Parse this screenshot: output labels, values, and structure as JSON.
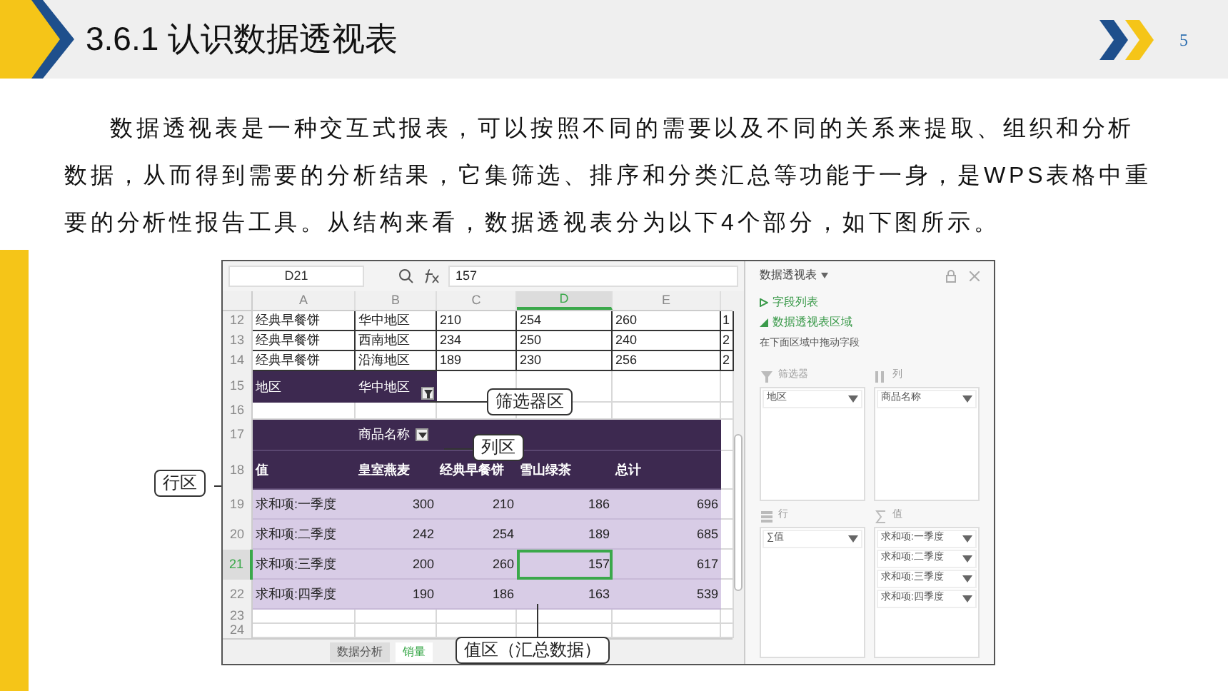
{
  "slide": {
    "title": "3.6.1 认识数据透视表",
    "page_number": "5",
    "paragraph": "数据透视表是一种交互式报表，可以按照不同的需要以及不同的关系来提取、组织和分析数据，从而得到需要的分析结果，它集筛选、排序和分类汇总等功能于一身，是WPS表格中重要的分析性报告工具。从结构来看，数据透视表分为以下4个部分，如下图所示。"
  },
  "spreadsheet": {
    "name_box": "D21",
    "formula": "157",
    "columns": [
      {
        "label": "A",
        "selected": false
      },
      {
        "label": "B",
        "selected": false
      },
      {
        "label": "C",
        "selected": false
      },
      {
        "label": "D",
        "selected": true
      },
      {
        "label": "E",
        "selected": false
      }
    ],
    "rows": [
      {
        "number": "12",
        "kind": "data",
        "selected": false,
        "cells": [
          "经典早餐饼",
          "华中地区",
          "210",
          "254",
          "260",
          "1"
        ]
      },
      {
        "number": "13",
        "kind": "data",
        "selected": false,
        "cells": [
          "经典早餐饼",
          "西南地区",
          "234",
          "250",
          "240",
          "2"
        ]
      },
      {
        "number": "14",
        "kind": "data",
        "selected": false,
        "cells": [
          "经典早餐饼",
          "沿海地区",
          "189",
          "230",
          "256",
          "2"
        ]
      },
      {
        "number": "15",
        "kind": "filter",
        "selected": false,
        "cells": [
          "地区",
          "华中地区"
        ]
      },
      {
        "number": "16",
        "kind": "blank",
        "selected": false,
        "cells": []
      },
      {
        "number": "17",
        "kind": "colfield",
        "selected": false,
        "cells": [
          "",
          "商品名称"
        ]
      },
      {
        "number": "18",
        "kind": "header",
        "selected": false,
        "cells": [
          "值",
          "皇室燕麦",
          "经典早餐饼",
          "雪山绿茶",
          "总计"
        ]
      },
      {
        "number": "19",
        "kind": "value",
        "selected": false,
        "cells": [
          "求和项:一季度",
          "300",
          "210",
          "186",
          "696"
        ]
      },
      {
        "number": "20",
        "kind": "value",
        "selected": false,
        "cells": [
          "求和项:二季度",
          "242",
          "254",
          "189",
          "685"
        ]
      },
      {
        "number": "21",
        "kind": "value",
        "selected": true,
        "cells": [
          "求和项:三季度",
          "200",
          "260",
          "157",
          "617"
        ]
      },
      {
        "number": "22",
        "kind": "value",
        "selected": false,
        "cells": [
          "求和项:四季度",
          "190",
          "186",
          "163",
          "539"
        ]
      },
      {
        "number": "23",
        "kind": "blank",
        "selected": false,
        "cells": []
      },
      {
        "number": "24",
        "kind": "blank",
        "selected": false,
        "cells": []
      }
    ],
    "sheet_tabs": [
      {
        "label": "数据分析",
        "selected": false
      },
      {
        "label": "销量",
        "selected": true
      }
    ]
  },
  "callouts": [
    {
      "kind": "filter",
      "text": "筛选器区"
    },
    {
      "kind": "column",
      "text": "列区"
    },
    {
      "kind": "row",
      "text": "行区"
    },
    {
      "kind": "value",
      "text": "值区（汇总数据）"
    }
  ],
  "panel": {
    "title": "数据透视表",
    "sections": [
      {
        "label": "字段列表",
        "expanded": false
      },
      {
        "label": "数据透视表区域",
        "expanded": true
      }
    ],
    "hint": "在下面区域中拖动字段",
    "areas": [
      {
        "kind": "filter",
        "label": "筛选器",
        "items": [
          "地区"
        ]
      },
      {
        "kind": "column",
        "label": "列",
        "items": [
          "商品名称"
        ]
      },
      {
        "kind": "row",
        "label": "行",
        "items": [
          "∑值"
        ]
      },
      {
        "kind": "value",
        "label": "值",
        "items": [
          "求和项:一季度",
          "求和项:二季度",
          "求和项:三季度",
          "求和项:四季度"
        ]
      }
    ]
  }
}
